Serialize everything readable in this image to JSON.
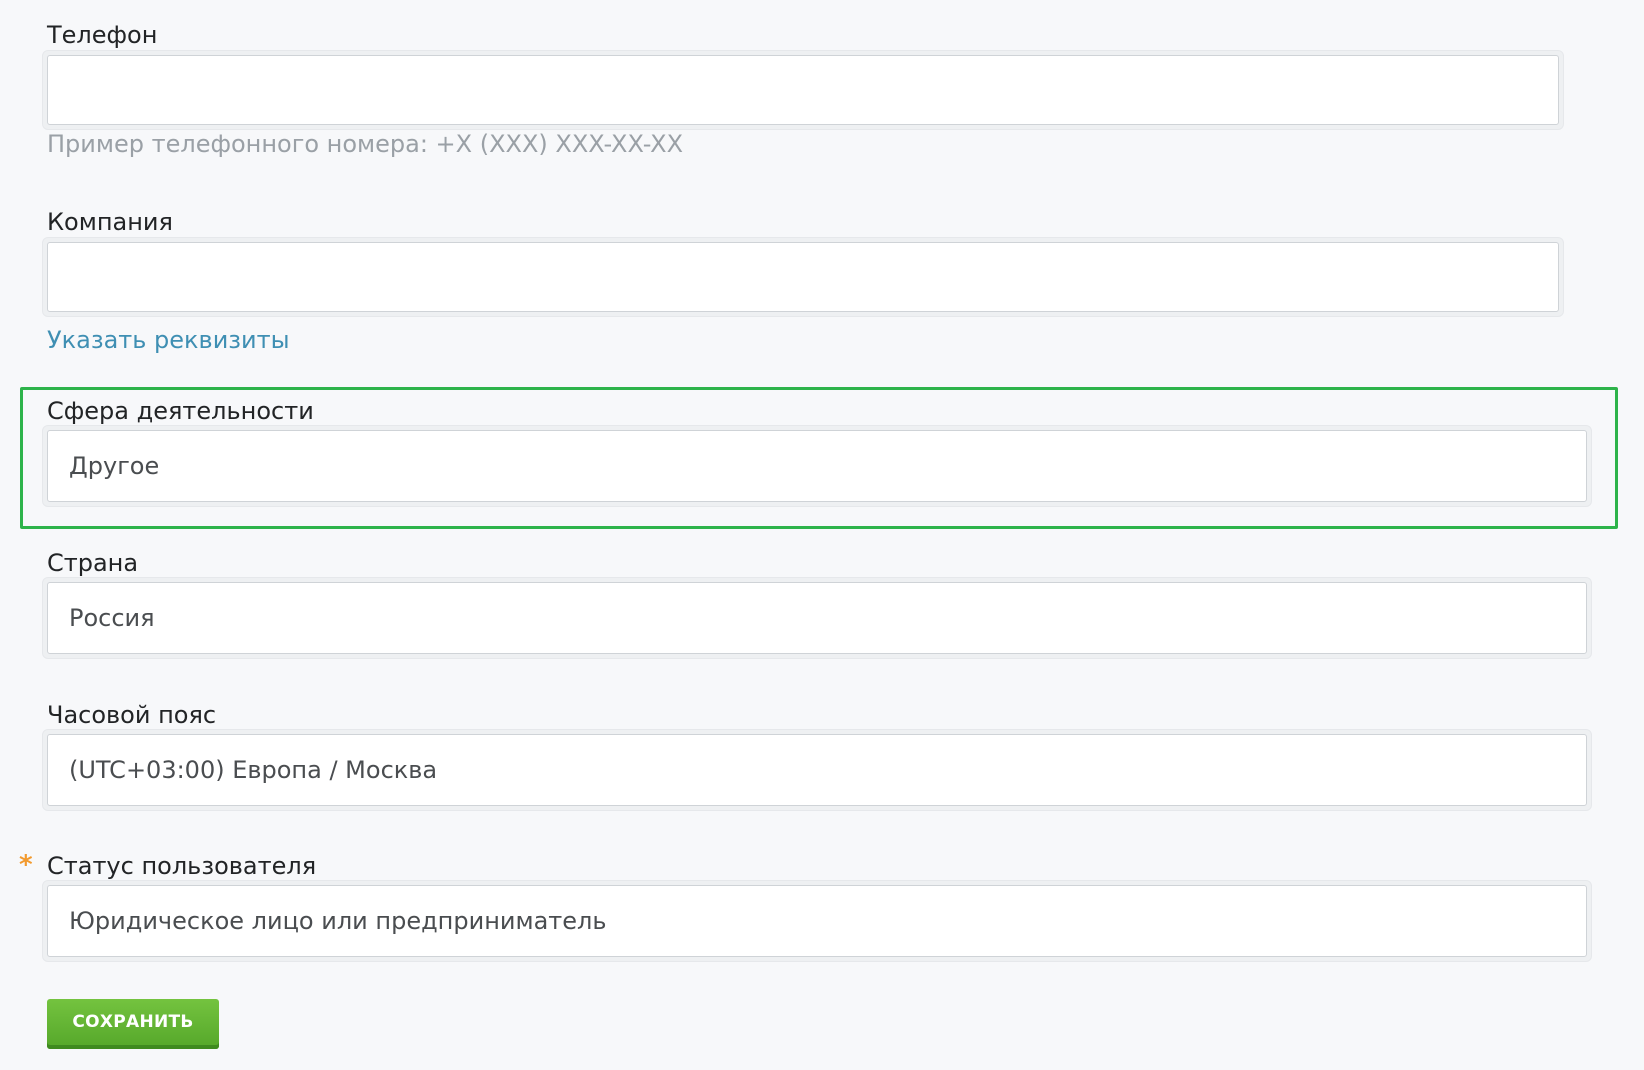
{
  "form": {
    "phone": {
      "label": "Телефон",
      "value": "",
      "hint": "Пример телефонного номера: +X (XXX) XXX-XX-XX"
    },
    "company": {
      "label": "Компания",
      "value": "",
      "link": "Указать реквизиты"
    },
    "industry": {
      "label": "Сфера деятельности",
      "value": "Другое"
    },
    "country": {
      "label": "Страна",
      "value": "Россия"
    },
    "timezone": {
      "label": "Часовой пояс",
      "value": "(UTC+03:00) Европа / Москва"
    },
    "user_status": {
      "label": "Статус пользователя",
      "required_mark": "*",
      "value": "Юридическое лицо или предприниматель"
    },
    "save_label": "СОХРАНИТЬ"
  },
  "colors": {
    "highlight": "#2db34a",
    "link": "#3f8fb3",
    "required": "#f29a2e",
    "button": "#5cb030"
  }
}
